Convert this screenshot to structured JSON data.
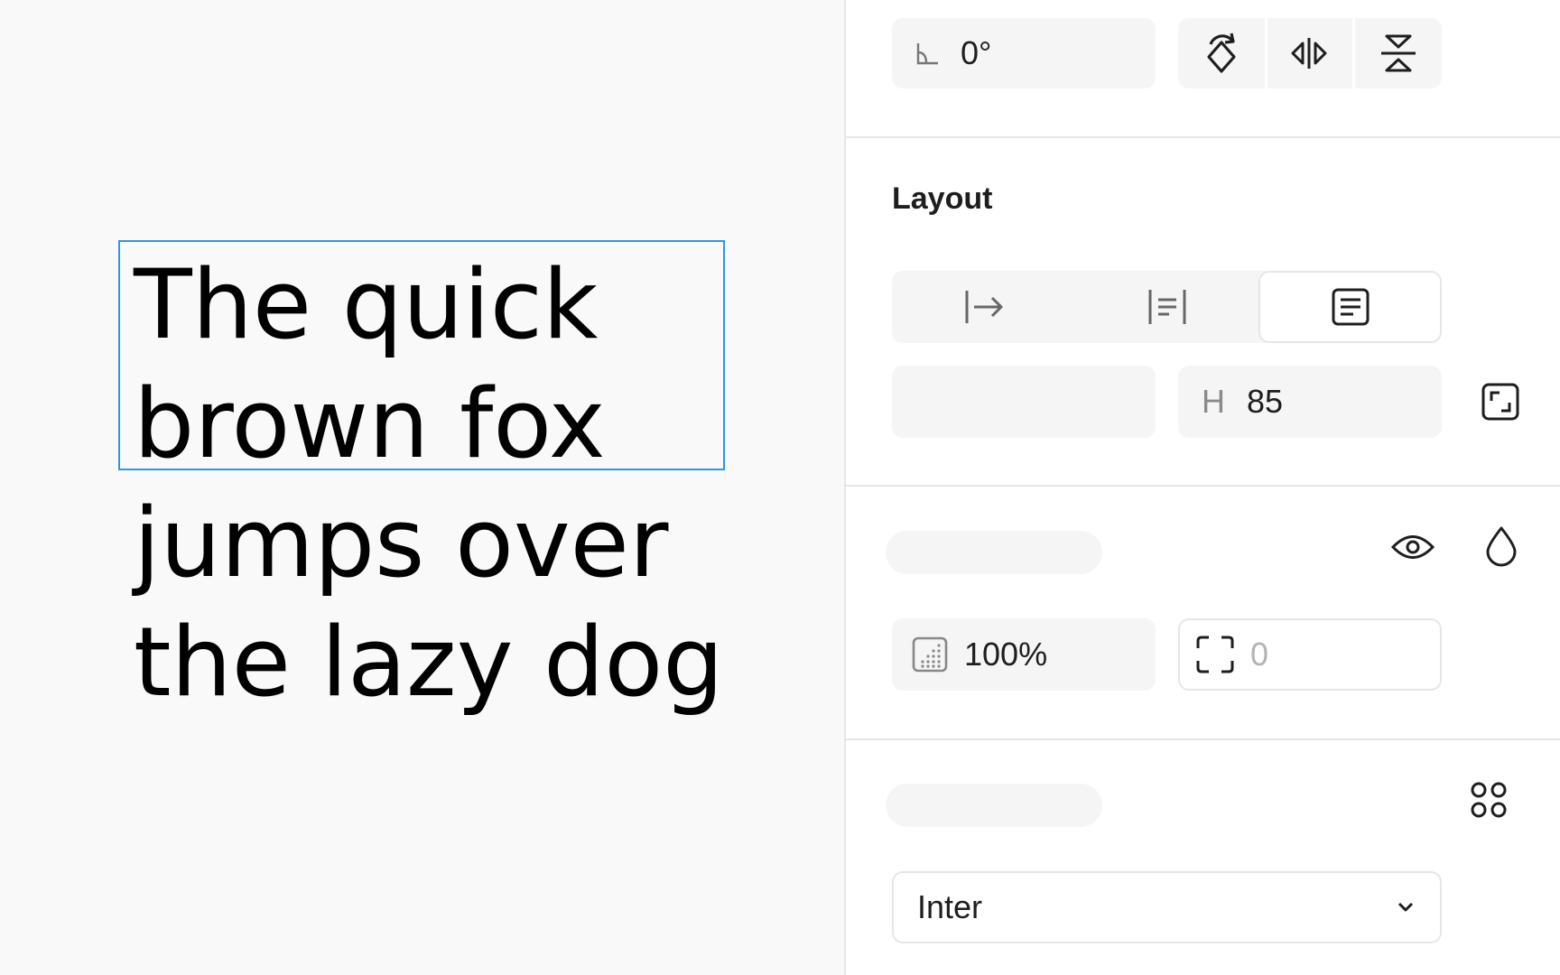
{
  "canvas": {
    "text_lines": [
      "The quick",
      "brown fox",
      "jumps over",
      "the lazy dog"
    ]
  },
  "panel": {
    "rotation": {
      "value": "0°",
      "icon": "angle-icon"
    },
    "transform_buttons": [
      {
        "name": "rotate-icon"
      },
      {
        "name": "flip-horizontal-icon"
      },
      {
        "name": "flip-vertical-icon"
      }
    ],
    "layout": {
      "title": "Layout",
      "modes": [
        {
          "name": "auto-width-icon"
        },
        {
          "name": "auto-height-icon"
        },
        {
          "name": "fixed-size-icon",
          "active": true
        }
      ],
      "height_label": "H",
      "height_value": "85"
    },
    "appearance": {
      "opacity": "100%",
      "corner_radius_placeholder": "0"
    },
    "typography": {
      "font_family": "Inter"
    }
  },
  "colors": {
    "selection": "#2f96e6",
    "canvas_bg": "#f9f9f9",
    "field_bg": "#f5f5f5",
    "divider": "#e6e6e6"
  }
}
